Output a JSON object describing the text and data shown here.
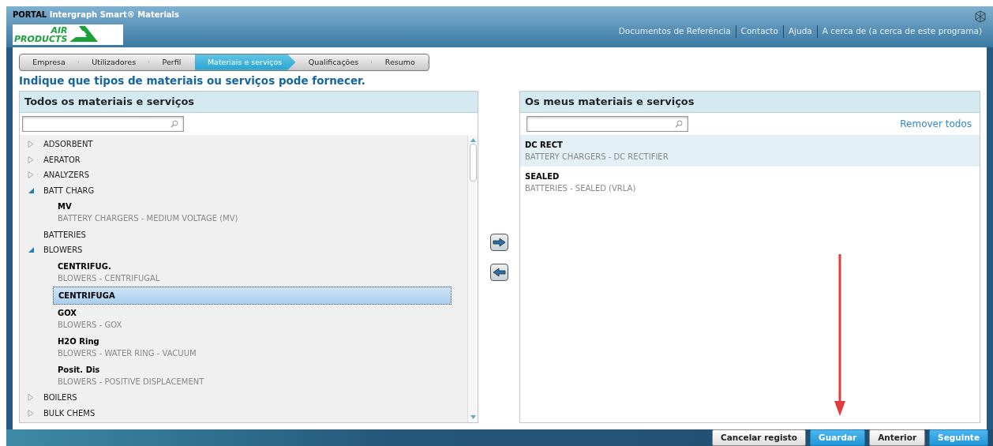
{
  "header": {
    "portal_label": "PORTAL",
    "product_name": "Intergraph Smart® Materials",
    "logo_top": "AIR",
    "logo_bottom": "PRODUCTS",
    "links": [
      "Documentos de Referência",
      "Contacto",
      "Ajuda",
      "A cerca de (a cerca de este programa)"
    ]
  },
  "steps": [
    {
      "label": "Empresa",
      "selected": false
    },
    {
      "label": "Utilizadores",
      "selected": false
    },
    {
      "label": "Perfil",
      "selected": false
    },
    {
      "label": "Materiais e serviços",
      "selected": true
    },
    {
      "label": "Qualificações",
      "selected": false
    },
    {
      "label": "Resumo",
      "selected": false
    }
  ],
  "instruction": "Indique que tipos de materiais ou serviços pode fornecer.",
  "all_panel": {
    "title": "Todos os materiais e serviços",
    "tree": [
      {
        "label": "ADSORBENT",
        "kind": "group",
        "expanded": false
      },
      {
        "label": "AERATOR",
        "kind": "group",
        "expanded": false
      },
      {
        "label": "ANALYZERS",
        "kind": "group",
        "expanded": false
      },
      {
        "label": "BATT CHARG",
        "kind": "group",
        "expanded": true,
        "children": [
          {
            "code": "MV",
            "description": "BATTERY CHARGERS - MEDIUM VOLTAGE (MV)",
            "selected": false
          }
        ]
      },
      {
        "label": "BATTERIES",
        "kind": "leaf"
      },
      {
        "label": "BLOWERS",
        "kind": "group",
        "expanded": true,
        "children": [
          {
            "code": "CENTRIFUG.",
            "description": "BLOWERS - CENTRIFUGAL",
            "selected": false
          },
          {
            "code": "CENTRIFUGA",
            "selected": true
          },
          {
            "code": "GOX",
            "description": "BLOWERS - GOX",
            "selected": false
          },
          {
            "code": "H2O Ring",
            "description": "BLOWERS - WATER RING - VACUUM",
            "selected": false
          },
          {
            "code": "Posit. Dis",
            "description": "BLOWERS - POSITIVE DISPLACEMENT",
            "selected": false
          }
        ]
      },
      {
        "label": "BOILERS",
        "kind": "group",
        "expanded": false
      },
      {
        "label": "BULK CHEMS",
        "kind": "group",
        "expanded": false
      }
    ]
  },
  "my_panel": {
    "title": "Os meus materiais e serviços",
    "remove_all": "Remover todos",
    "items": [
      {
        "code": "DC RECT",
        "description": "BATTERY CHARGERS - DC RECTIFIER",
        "selected": true
      },
      {
        "code": "SEALED",
        "description": "BATTERIES - SEALED  (VRLA)",
        "selected": false
      }
    ]
  },
  "footer_buttons": [
    {
      "label": "Cancelar registo",
      "kind": "secondary"
    },
    {
      "label": "Guardar",
      "kind": "primary"
    },
    {
      "label": "Anterior",
      "kind": "secondary"
    },
    {
      "label": "Seguinte",
      "kind": "primary"
    }
  ]
}
